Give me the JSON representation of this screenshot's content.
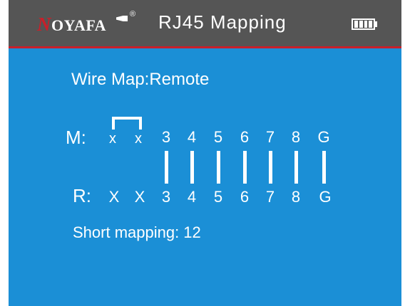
{
  "header": {
    "brand_initial": "N",
    "brand_rest": "OYAFA",
    "registered_mark": "®",
    "title": "RJ45  Mapping",
    "battery_icon": "battery-full-icon"
  },
  "screen": {
    "wire_map_label": "Wire Map:Remote",
    "main_row_label": "M:",
    "remote_row_label": "R:",
    "main_pins": [
      "x",
      "x",
      "3",
      "4",
      "5",
      "6",
      "7",
      "8",
      "G"
    ],
    "remote_pins": [
      "X",
      "X",
      "3",
      "4",
      "5",
      "6",
      "7",
      "8",
      "G"
    ],
    "connected_pins": [
      "3",
      "4",
      "5",
      "6",
      "7",
      "8",
      "G"
    ],
    "short_pair": [
      "1",
      "2"
    ],
    "status_text": "Short mapping: 12"
  },
  "colors": {
    "screen_bg": "#1b8fd6",
    "header_bg": "#555555",
    "accent_red": "#c8202a",
    "foreground": "#ffffff"
  }
}
